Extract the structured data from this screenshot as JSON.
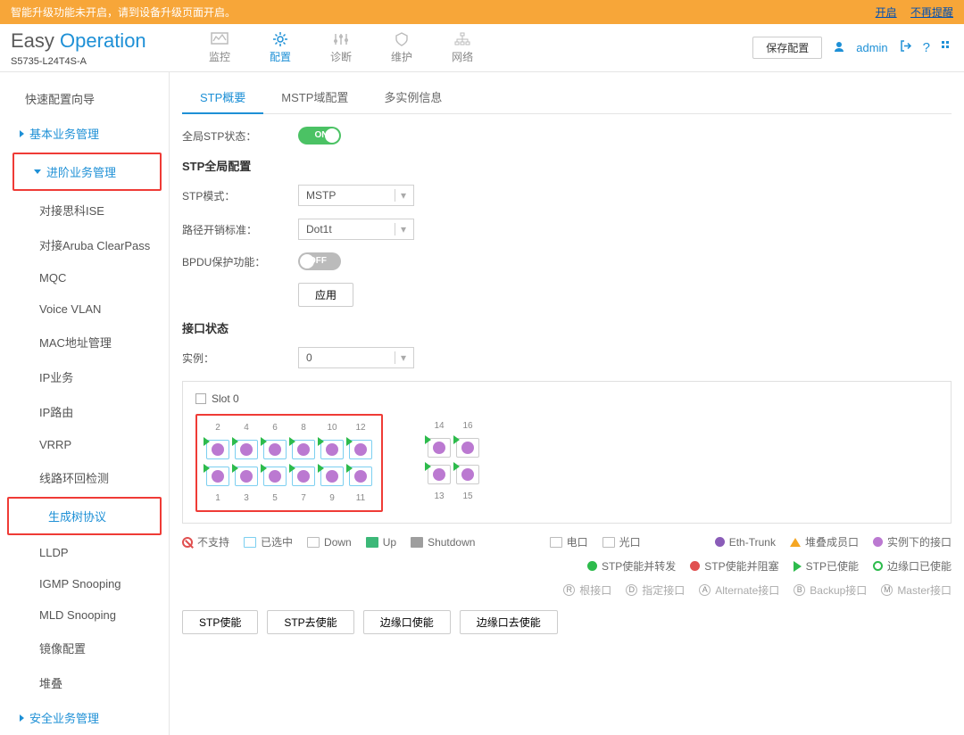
{
  "banner": {
    "text": "智能升级功能未开启，请到设备升级页面开启。",
    "open": "开启",
    "dismiss": "不再提醒"
  },
  "logo": {
    "easy": "Easy",
    "op": "Operation",
    "model": "S5735-L24T4S-A"
  },
  "topnav": {
    "monitor": "监控",
    "config": "配置",
    "diagnose": "诊断",
    "maintain": "维护",
    "network": "网络"
  },
  "header": {
    "save": "保存配置",
    "user": "admin",
    "help": "?"
  },
  "sidebar": {
    "wizard": "快速配置向导",
    "basic": "基本业务管理",
    "adv": "进阶业务管理",
    "items": [
      "对接思科ISE",
      "对接Aruba ClearPass",
      "MQC",
      "Voice VLAN",
      "MAC地址管理",
      "IP业务",
      "IP路由",
      "VRRP",
      "线路环回检测",
      "生成树协议",
      "LLDP",
      "IGMP Snooping",
      "MLD Snooping",
      "镜像配置",
      "堆叠"
    ],
    "security": "安全业务管理"
  },
  "tabs": {
    "summary": "STP概要",
    "mstp": "MSTP域配置",
    "multi": "多实例信息"
  },
  "form": {
    "globalStp": "全局STP状态：",
    "on": "ON",
    "off": "OFF",
    "globalCfg": "STP全局配置",
    "mode": "STP模式：",
    "modeVal": "MSTP",
    "pathcost": "路径开销标准：",
    "pathcostVal": "Dot1t",
    "bpdu": "BPDU保护功能：",
    "apply": "应用",
    "portStatus": "接口状态",
    "instance": "实例：",
    "instanceVal": "0",
    "slot": "Slot 0"
  },
  "ports": {
    "topNums": [
      "2",
      "4",
      "6",
      "8",
      "10",
      "12"
    ],
    "botNums": [
      "1",
      "3",
      "5",
      "7",
      "9",
      "11"
    ],
    "sideTop": [
      "14",
      "16"
    ],
    "sideBot": [
      "13",
      "15"
    ]
  },
  "legend1": {
    "nosupport": "不支持",
    "selected": "已选中",
    "down": "Down",
    "up": "Up",
    "shutdown": "Shutdown",
    "elec": "电口",
    "optical": "光口",
    "eth": "Eth-Trunk",
    "stack": "堆叠成员口",
    "inst": "实例下的接口"
  },
  "legend2": {
    "fwd": "STP使能并转发",
    "block": "STP使能并阻塞",
    "enabled": "STP已使能",
    "edge": "边缘口已使能"
  },
  "legend3": {
    "root": "根接口",
    "designated": "指定接口",
    "alternate": "Alternate接口",
    "backup": "Backup接口",
    "master": "Master接口"
  },
  "actions": {
    "enable": "STP使能",
    "disable": "STP去使能",
    "edgeEnable": "边缘口使能",
    "edgeDisable": "边缘口去使能"
  }
}
